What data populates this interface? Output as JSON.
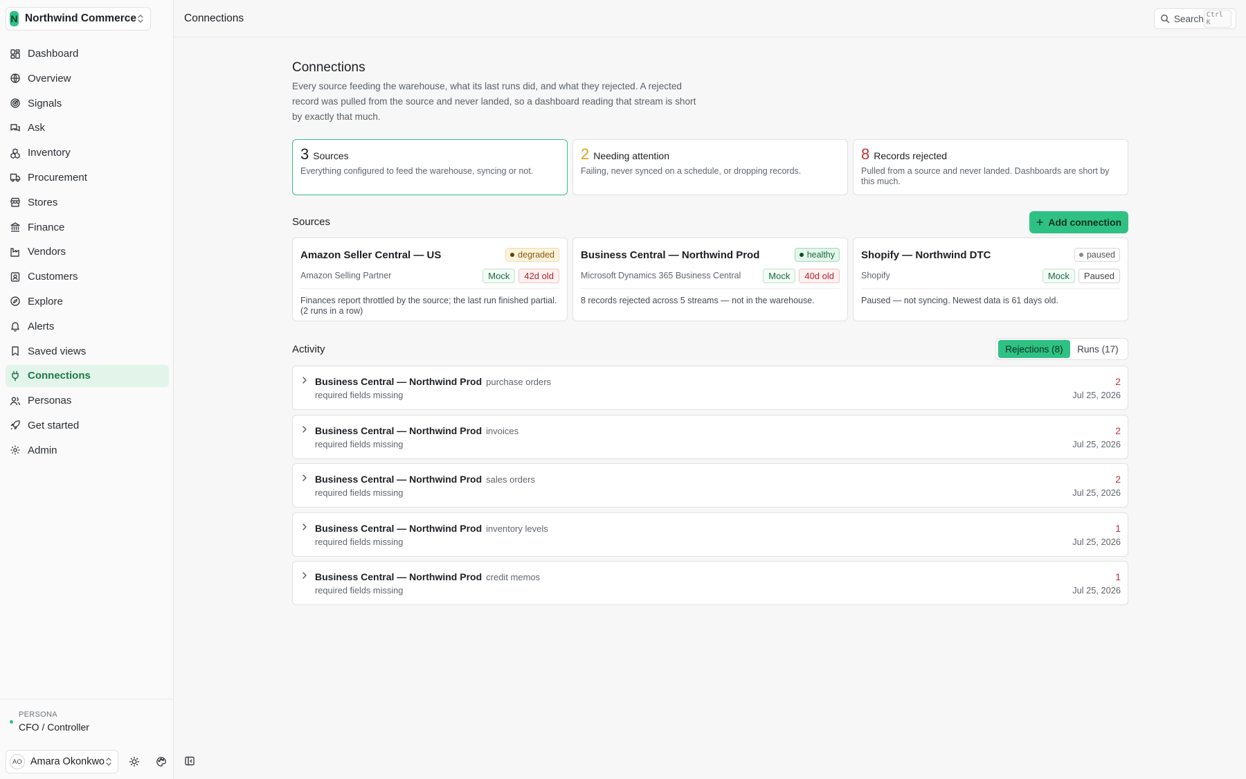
{
  "org": {
    "initial": "N",
    "name": "Northwind Commerce"
  },
  "nav": [
    {
      "label": "Dashboard",
      "icon": "dashboard-icon"
    },
    {
      "label": "Overview",
      "icon": "globe-icon"
    },
    {
      "label": "Signals",
      "icon": "signals-icon"
    },
    {
      "label": "Ask",
      "icon": "chat-icon"
    },
    {
      "label": "Inventory",
      "icon": "boxes-icon"
    },
    {
      "label": "Procurement",
      "icon": "truck-icon"
    },
    {
      "label": "Stores",
      "icon": "store-icon"
    },
    {
      "label": "Finance",
      "icon": "bank-icon"
    },
    {
      "label": "Vendors",
      "icon": "factory-icon"
    },
    {
      "label": "Customers",
      "icon": "contact-icon"
    },
    {
      "label": "Explore",
      "icon": "compass-icon"
    },
    {
      "label": "Alerts",
      "icon": "bell-icon"
    },
    {
      "label": "Saved views",
      "icon": "bookmark-icon"
    },
    {
      "label": "Connections",
      "icon": "plug-icon",
      "active": true
    },
    {
      "label": "Personas",
      "icon": "users-icon"
    },
    {
      "label": "Get started",
      "icon": "rocket-icon"
    },
    {
      "label": "Admin",
      "icon": "gear-icon"
    }
  ],
  "persona": {
    "kicker": "PERSONA",
    "role": "CFO / Controller"
  },
  "user": {
    "initials": "AO",
    "name": "Amara Okonkwo"
  },
  "topbar": {
    "title": "Connections",
    "search_label": "Search",
    "search_shortcut": "Ctrl K"
  },
  "page": {
    "title": "Connections",
    "description": "Every source feeding the warehouse, what its last runs did, and what they rejected. A rejected record was pulled from the source and never landed, so a dashboard reading that stream is short by exactly that much."
  },
  "stats": [
    {
      "value": "3",
      "label": "Sources",
      "desc": "Everything configured to feed the warehouse, syncing or not.",
      "color": "#1c1f23",
      "selected": true
    },
    {
      "value": "2",
      "label": "Needing attention",
      "desc": "Failing, never synced on a schedule, or dropping records.",
      "color": "#e0a21b"
    },
    {
      "value": "8",
      "label": "Records rejected",
      "desc": "Pulled from a source and never landed. Dashboards are short by this much.",
      "color": "#c0303a"
    }
  ],
  "sources_section": {
    "title": "Sources",
    "add_label": "Add connection"
  },
  "sources": [
    {
      "name": "Amazon Seller Central — US",
      "status": "degraded",
      "provider": "Amazon Selling Partner",
      "mock": "Mock",
      "age": "42d old",
      "note": "Finances report throttled by the source; the last run finished partial. (2 runs in a row)"
    },
    {
      "name": "Business Central — Northwind Prod",
      "status": "healthy",
      "provider": "Microsoft Dynamics 365 Business Central",
      "mock": "Mock",
      "age": "40d old",
      "note": "8 records rejected across 5 streams — not in the warehouse."
    },
    {
      "name": "Shopify — Northwind DTC",
      "status": "paused",
      "provider": "Shopify",
      "mock": "Mock",
      "age": "Paused",
      "note": "Paused — not syncing. Newest data is 61 days old."
    }
  ],
  "activity": {
    "title": "Activity",
    "tabs": [
      {
        "label": "Rejections (8)",
        "active": true
      },
      {
        "label": "Runs (17)"
      }
    ],
    "rows": [
      {
        "source": "Business Central — Northwind Prod",
        "stream": "purchase orders",
        "reason": "required fields missing",
        "count": "2",
        "date": "Jul 25, 2026"
      },
      {
        "source": "Business Central — Northwind Prod",
        "stream": "invoices",
        "reason": "required fields missing",
        "count": "2",
        "date": "Jul 25, 2026"
      },
      {
        "source": "Business Central — Northwind Prod",
        "stream": "sales orders",
        "reason": "required fields missing",
        "count": "2",
        "date": "Jul 25, 2026"
      },
      {
        "source": "Business Central — Northwind Prod",
        "stream": "inventory levels",
        "reason": "required fields missing",
        "count": "1",
        "date": "Jul 25, 2026"
      },
      {
        "source": "Business Central — Northwind Prod",
        "stream": "credit memos",
        "reason": "required fields missing",
        "count": "1",
        "date": "Jul 25, 2026"
      }
    ]
  },
  "colors": {
    "accent": "#2fc184",
    "accent_text": "#1c7a4c",
    "danger": "#c0303a",
    "warning": "#e0a21b"
  }
}
